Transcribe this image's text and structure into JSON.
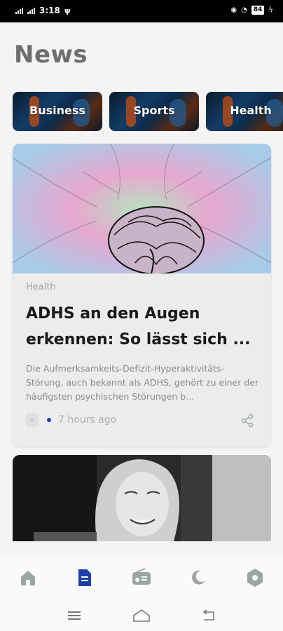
{
  "status_bar": {
    "time": "3:18",
    "battery": "84"
  },
  "header": {
    "title": "News"
  },
  "categories": [
    {
      "label": "Business"
    },
    {
      "label": "Sports"
    },
    {
      "label": "Health"
    }
  ],
  "featured_article": {
    "category": "Health",
    "title": "ADHS an den Augen erkennen: So lässt sich ...",
    "description": "Die Aufmerksamkeits-Defizit-Hyperaktivitäts-Störung, auch bekannt als ADHS, gehört zu einer der häufigsten psychischen Störungen b...",
    "time": "7 hours ago"
  },
  "bottom_nav": [
    {
      "icon": "home-icon"
    },
    {
      "icon": "article-icon",
      "active": true
    },
    {
      "icon": "radio-icon"
    },
    {
      "icon": "moon-icon"
    },
    {
      "icon": "settings-icon"
    }
  ],
  "colors": {
    "accent": "#1f3fa8",
    "nav_inactive": "#9aa5a5",
    "title": "#6e6e6e"
  }
}
